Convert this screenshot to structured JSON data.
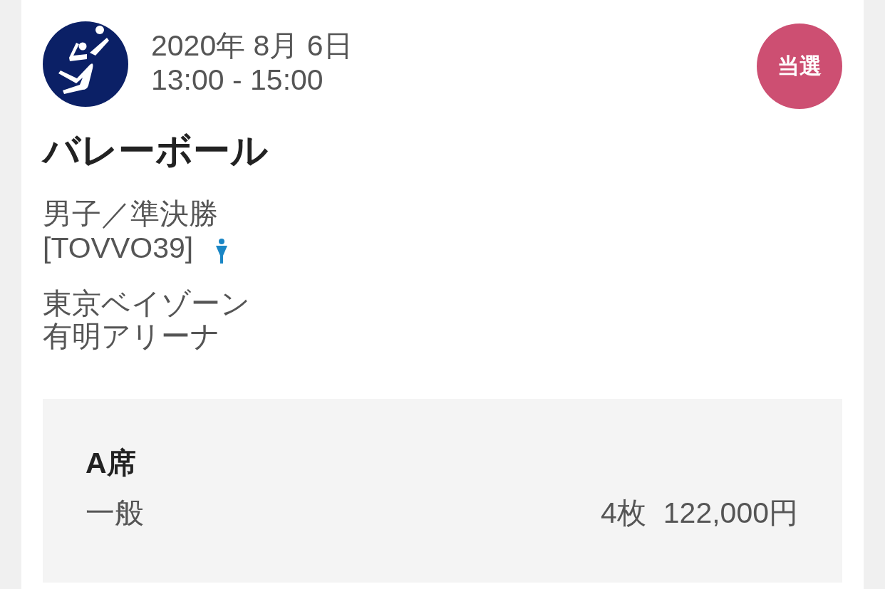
{
  "event": {
    "date": "2020年 8月 6日",
    "time": "13:00 - 15:00",
    "status_badge": "当選",
    "sport": "バレーボール",
    "session": "男子／準決勝",
    "code": "[TOVVO39]",
    "venue_lines": [
      "東京ベイゾーン",
      "有明アリーナ"
    ]
  },
  "tickets": [
    {
      "seat": "A席",
      "category": "一般",
      "quantity": "4枚",
      "price": "122,000円"
    }
  ]
}
